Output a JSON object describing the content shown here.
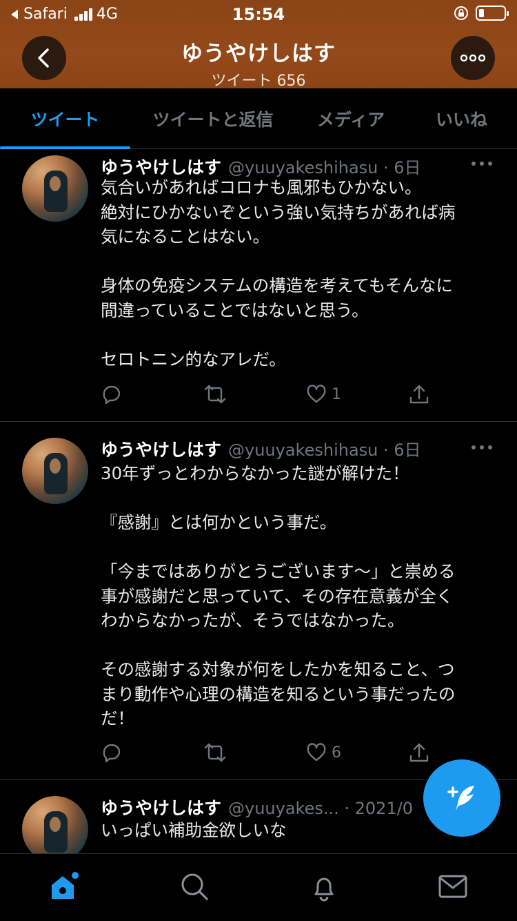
{
  "status_bar": {
    "carrier": "Safari",
    "network": "4G",
    "time": "15:54"
  },
  "header": {
    "title": "ゆうやけしはす",
    "subtitle": "ツイート 656"
  },
  "tabs": [
    {
      "label": "ツイート",
      "active": true
    },
    {
      "label": "ツイートと返信",
      "active": false
    },
    {
      "label": "メディア",
      "active": false
    },
    {
      "label": "いいね",
      "active": false
    }
  ],
  "tweets": [
    {
      "name": "ゆうやけしはす",
      "handle": "@yuuyakeshihasu · 6日",
      "lines": [
        "気合いがあればコロナも風邪もひかない。",
        "絶対にひかないぞという強い気持ちがあれば病",
        "気になることはない。",
        "",
        "身体の免疫システムの構造を考えてもそんなに",
        "間違っていることではないと思う。",
        "",
        "セロトニン的なアレだ。"
      ],
      "likes": "1"
    },
    {
      "name": "ゆうやけしはす",
      "handle": "@yuuyakeshihasu · 6日",
      "lines": [
        "30年ずっとわからなかった謎が解けた！",
        "",
        "『感謝』とは何かという事だ。",
        "",
        "「今まではありがとうございます〜」と崇める",
        "事が感謝だと思っていて、その存在意義が全く",
        "わからなかったが、そうではなかった。",
        "",
        "その感謝する対象が何をしたかを知ること、つ",
        "まり動作や心理の構造を知るという事だったの",
        "だ！"
      ],
      "likes": "6"
    },
    {
      "name": "ゆうやけしはす",
      "handle": "@yuuyakes... · 2021/0",
      "lines": [
        "いっぱい補助金欲しいな"
      ],
      "likes": ""
    }
  ],
  "colors": {
    "header_bg": "#8a4416",
    "accent": "#1d9bf0",
    "muted": "#71767b"
  }
}
